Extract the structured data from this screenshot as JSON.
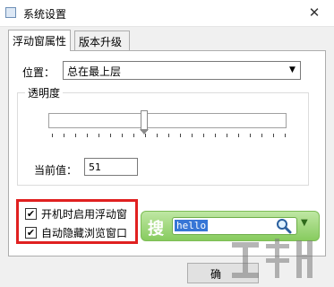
{
  "window": {
    "title": "系统设置",
    "close_glyph": "✕"
  },
  "tabs": [
    {
      "label": "浮动窗属性",
      "active": true
    },
    {
      "label": "版本升级",
      "active": false
    }
  ],
  "position": {
    "label": "位置：",
    "value": "总在最上层"
  },
  "transparency": {
    "group_title": "透明度",
    "current_label": "当前值：",
    "current_value": "51"
  },
  "options": [
    {
      "label": "开机时启用浮动窗",
      "checked": true
    },
    {
      "label": "自动隐藏浏览窗口",
      "checked": true
    }
  ],
  "search_widget": {
    "icon_char": "搜",
    "query": "hello"
  },
  "footer": {
    "ok_label": "确"
  },
  "colors": {
    "highlight_box": "#e02020",
    "widget_green": "#87cb5f",
    "selection_blue": "#3776d6"
  }
}
